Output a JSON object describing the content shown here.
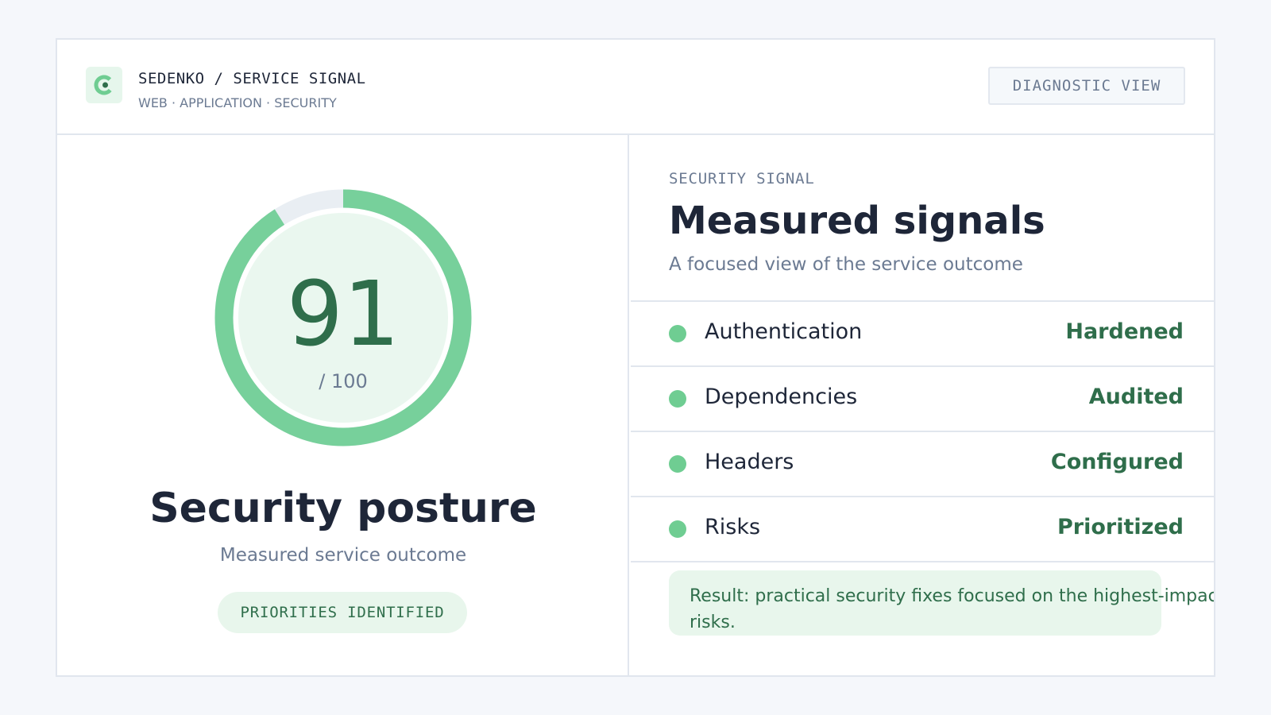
{
  "header": {
    "title": "SEDENKO / SERVICE SIGNAL",
    "subtitle": "WEB · APPLICATION · SECURITY",
    "diagnostic_label": "DIAGNOSTIC VIEW"
  },
  "score": {
    "value": "91",
    "max_label": "/ 100",
    "fraction": 0.91,
    "title": "Security posture",
    "subtitle": "Measured service outcome",
    "badge": "PRIORITIES IDENTIFIED"
  },
  "signals": {
    "eyebrow": "SECURITY SIGNAL",
    "title": "Measured signals",
    "subtitle": "A focused view of the service outcome",
    "rows": [
      {
        "label": "Authentication",
        "value": "Hardened"
      },
      {
        "label": "Dependencies",
        "value": "Audited"
      },
      {
        "label": "Headers",
        "value": "Configured"
      },
      {
        "label": "Risks",
        "value": "Prioritized"
      }
    ],
    "result": "Result: practical security fixes focused on the highest-impact risks."
  },
  "colors": {
    "accent": "#6fcd92",
    "accent_dark": "#2f6e4b",
    "accent_soft": "#e8f6ec",
    "track": "#e9eef3"
  },
  "icons": {
    "logo": "brand-logo-icon",
    "row_status": "status-dot-icon"
  }
}
